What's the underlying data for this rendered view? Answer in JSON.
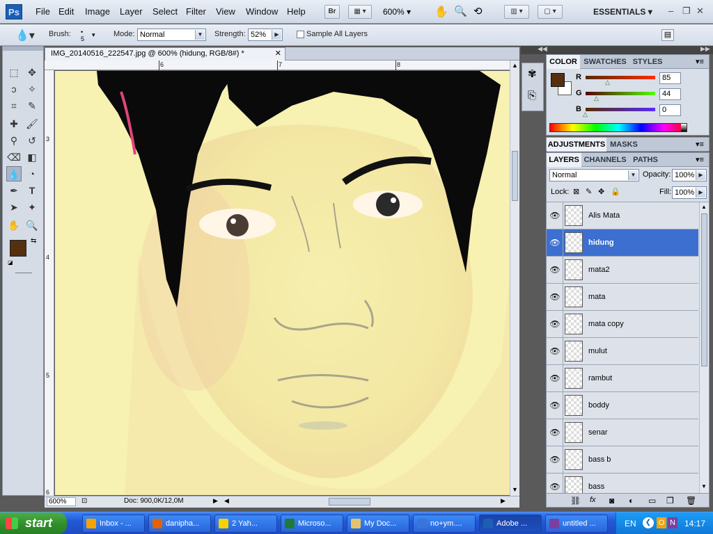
{
  "app": {
    "logo": "Ps",
    "workspace": "ESSENTIALS"
  },
  "menu": [
    "File",
    "Edit",
    "Image",
    "Layer",
    "Select",
    "Filter",
    "View",
    "Window",
    "Help"
  ],
  "toolbar": {
    "bridge": "Br",
    "zoom_value": "600%"
  },
  "window_controls": {
    "minimize": "–",
    "restore": "❐",
    "close": "✕"
  },
  "options": {
    "brush_label": "Brush:",
    "brush_size": "5",
    "mode_label": "Mode:",
    "mode_value": "Normal",
    "strength_label": "Strength:",
    "strength_value": "52%",
    "sample_all_label": "Sample All Layers"
  },
  "document": {
    "tab_title": "IMG_20140516_222547.jpg @ 600% (hidung, RGB/8#) *",
    "close": "✕",
    "ruler_top": [
      "6",
      "7",
      "8"
    ],
    "ruler_left": [
      "3",
      "4",
      "5",
      "6"
    ],
    "zoom": "600%",
    "doc_info": "Doc: 900,0K/12,0M"
  },
  "colors": {
    "foreground": "#553010",
    "background": "#ffffff",
    "skin": "#f6efae",
    "hair": "#0a0a0a"
  },
  "color_panel": {
    "tabs": [
      "COLOR",
      "SWATCHES",
      "STYLES"
    ],
    "r_label": "R",
    "r_value": "85",
    "g_label": "G",
    "g_value": "44",
    "b_label": "B",
    "b_value": "0"
  },
  "adjustments_panel": {
    "tabs": [
      "ADJUSTMENTS",
      "MASKS"
    ]
  },
  "layers_panel": {
    "tabs": [
      "LAYERS",
      "CHANNELS",
      "PATHS"
    ],
    "blend_mode": "Normal",
    "opacity_label": "Opacity:",
    "opacity_value": "100%",
    "lock_label": "Lock:",
    "fill_label": "Fill:",
    "fill_value": "100%",
    "layers": [
      {
        "name": "Alis Mata"
      },
      {
        "name": "hidung",
        "selected": true
      },
      {
        "name": "mata2"
      },
      {
        "name": "mata"
      },
      {
        "name": "mata copy"
      },
      {
        "name": "mulut"
      },
      {
        "name": "rambut"
      },
      {
        "name": "boddy"
      },
      {
        "name": "senar"
      },
      {
        "name": "bass b"
      },
      {
        "name": "bass"
      }
    ]
  },
  "taskbar": {
    "start_label": "start",
    "tasks": [
      {
        "label": "Inbox - ..."
      },
      {
        "label": "danipha..."
      },
      {
        "label": "2 Yah..."
      },
      {
        "label": "Microso..."
      },
      {
        "label": "My Doc..."
      },
      {
        "label": "no+ym...."
      },
      {
        "label": "Adobe ...",
        "active": true
      },
      {
        "label": "untitled ..."
      }
    ],
    "lang": "EN",
    "clock": "14:17"
  }
}
